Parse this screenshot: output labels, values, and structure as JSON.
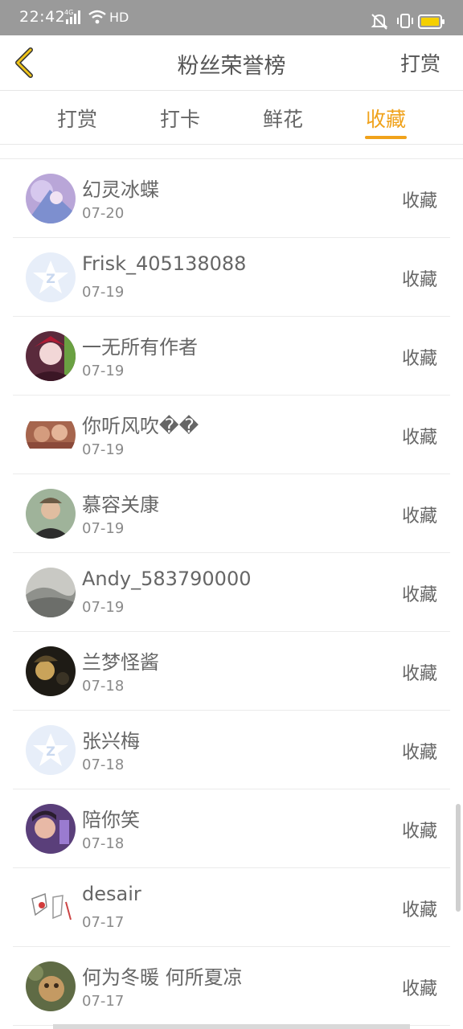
{
  "status_bar": {
    "time": "22:42",
    "network": "4G",
    "hd": "HD"
  },
  "header": {
    "title": "粉丝荣誉榜",
    "right_action": "打赏"
  },
  "tabs": [
    {
      "label": "打赏",
      "active": false
    },
    {
      "label": "打卡",
      "active": false
    },
    {
      "label": "鲜花",
      "active": false
    },
    {
      "label": "收藏",
      "active": true
    }
  ],
  "accent_color": "#f0a21b",
  "rows": [
    {
      "name": "幻灵冰蝶",
      "date": "07-20",
      "action": "收藏",
      "avatar": "anime-girl-avatar"
    },
    {
      "name": "Frisk_405138088",
      "date": "07-19",
      "action": "收藏",
      "avatar": "default-avatar"
    },
    {
      "name": "一无所有作者",
      "date": "07-19",
      "action": "收藏",
      "avatar": "dark-character-avatar"
    },
    {
      "name": "你听风吹��",
      "date": "07-19",
      "action": "收藏",
      "avatar": "photo-avatar"
    },
    {
      "name": "慕容关康",
      "date": "07-19",
      "action": "收藏",
      "avatar": "person-avatar"
    },
    {
      "name": "Andy_583790000",
      "date": "07-19",
      "action": "收藏",
      "avatar": "landscape-avatar"
    },
    {
      "name": "兰梦怪酱",
      "date": "07-18",
      "action": "收藏",
      "avatar": "dark-anime-avatar"
    },
    {
      "name": "张兴梅",
      "date": "07-18",
      "action": "收藏",
      "avatar": "default-avatar"
    },
    {
      "name": "陪你笑",
      "date": "07-18",
      "action": "收藏",
      "avatar": "selfie-avatar"
    },
    {
      "name": "desair",
      "date": "07-17",
      "action": "收藏",
      "avatar": "sketch-avatar"
    },
    {
      "name": "何为冬暖 何所夏凉",
      "date": "07-17",
      "action": "收藏",
      "avatar": "pet-avatar"
    }
  ]
}
